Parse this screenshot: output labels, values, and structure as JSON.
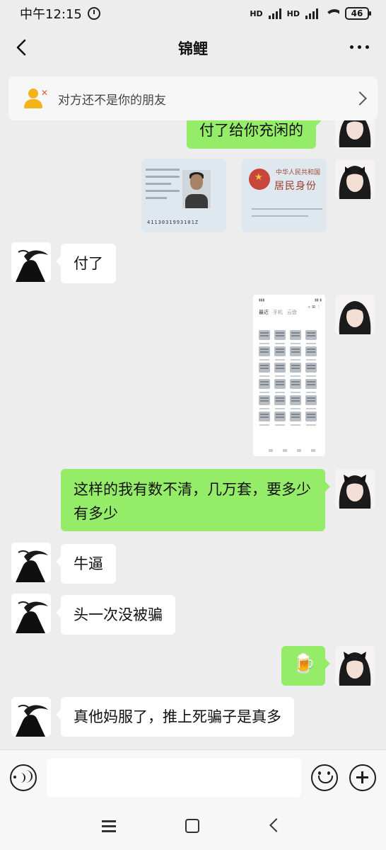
{
  "status_bar": {
    "time": "中午12:15",
    "signal_1": "HD",
    "signal_2": "HD",
    "battery": "46"
  },
  "nav": {
    "title": "锦鲤"
  },
  "banner": {
    "text": "对方还不是你的朋友"
  },
  "messages": [
    {
      "id": "m0",
      "side": "self",
      "type": "text",
      "text": "付了给你充闲的",
      "partial": true
    },
    {
      "id": "m1",
      "side": "self",
      "type": "image",
      "content": "id-card photos",
      "id_number": "4113031993101Z",
      "card_title": "中华人民共和国",
      "card_subtitle": "居民身份"
    },
    {
      "id": "m2",
      "side": "other",
      "type": "text",
      "text": "付了"
    },
    {
      "id": "m3",
      "side": "self",
      "type": "image",
      "content": "phone file list screenshot",
      "screenshot_tabs": [
        "最近",
        "手机",
        "云盘"
      ]
    },
    {
      "id": "m4",
      "side": "self",
      "type": "text",
      "text": "这样的我有数不清，几万套，要多少有多少"
    },
    {
      "id": "m5",
      "side": "other",
      "type": "text",
      "text": "牛逼"
    },
    {
      "id": "m6",
      "side": "other",
      "type": "text",
      "text": "头一次没被骗"
    },
    {
      "id": "m7",
      "side": "self",
      "type": "emoji",
      "emoji": "🍺"
    },
    {
      "id": "m8",
      "side": "other",
      "type": "text",
      "text": "真他妈服了，推上死骗子是真多"
    }
  ],
  "input_bar": {
    "value": ""
  },
  "colors": {
    "background": "#ededed",
    "outgoing_bubble": "#95ec69",
    "incoming_bubble": "#ffffff",
    "banner_icon": "#f3b31b"
  }
}
